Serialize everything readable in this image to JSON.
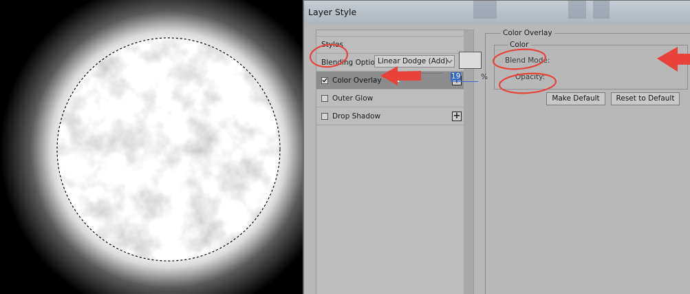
{
  "dialog": {
    "title": "Layer Style"
  },
  "styles_list": {
    "items": [
      {
        "label": "Styles",
        "has_checkbox": false,
        "checked": false,
        "selected": false,
        "has_plus": false
      },
      {
        "label": "Blending Options",
        "has_checkbox": false,
        "checked": false,
        "selected": false,
        "has_plus": false
      },
      {
        "label": "Color Overlay",
        "has_checkbox": true,
        "checked": true,
        "selected": true,
        "has_plus": true
      },
      {
        "label": "Outer Glow",
        "has_checkbox": true,
        "checked": false,
        "selected": false,
        "has_plus": false
      },
      {
        "label": "Drop Shadow",
        "has_checkbox": true,
        "checked": false,
        "selected": false,
        "has_plus": true
      }
    ],
    "plus_glyph": "+"
  },
  "color_overlay": {
    "group_title": "Color Overlay",
    "color_group_title": "Color",
    "blend_mode_label": "Blend Mode:",
    "blend_mode_value": "Linear Dodge (Add)",
    "opacity_label": "Opacity:",
    "opacity_value": "19",
    "opacity_unit": "%",
    "opacity_fraction": 0.19,
    "swatch_color": "#dcdcdc"
  },
  "buttons": {
    "make_default": "Make Default",
    "reset_to_default": "Reset to Default"
  },
  "annotation_color": "#e8423a",
  "icons": {
    "checkmark": "checkmark-icon",
    "plus": "plus-icon",
    "dropdown": "chevron-down-icon"
  }
}
